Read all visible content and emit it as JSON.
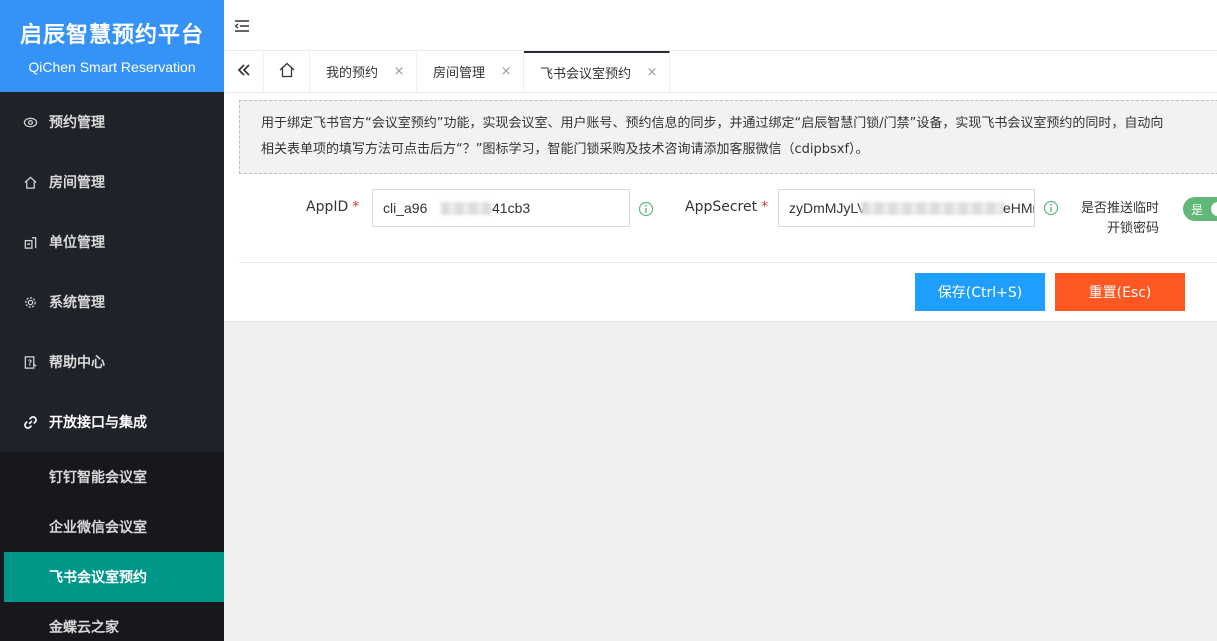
{
  "brand": {
    "title": "启辰智慧预约平台",
    "subtitle": "QiChen Smart Reservation"
  },
  "sidebar": {
    "items": [
      {
        "label": "预约管理",
        "icon": "eye-icon"
      },
      {
        "label": "房间管理",
        "icon": "home-icon"
      },
      {
        "label": "单位管理",
        "icon": "building-icon"
      },
      {
        "label": "系统管理",
        "icon": "gear-icon"
      },
      {
        "label": "帮助中心",
        "icon": "help-doc-icon"
      },
      {
        "label": "开放接口与集成",
        "icon": "link-icon"
      }
    ],
    "subitems": [
      {
        "label": "钉钉智能会议室"
      },
      {
        "label": "企业微信会议室"
      },
      {
        "label": "飞书会议室预约"
      },
      {
        "label": "金蝶云之家"
      }
    ]
  },
  "tabs": [
    {
      "label": "我的预约",
      "close": "×"
    },
    {
      "label": "房间管理",
      "close": "×"
    },
    {
      "label": "飞书会议室预约",
      "close": "×"
    }
  ],
  "notice": {
    "line1": "用于绑定飞书官方“会议室预约”功能，实现会议室、用户账号、预约信息的同步，并通过绑定“启辰智慧门锁/门禁”设备，实现飞书会议室预约的同时，自动向",
    "line2": "相关表单项的填写方法可点击后方“？”图标学习，智能门锁采购及技术咨询请添加客服微信（cdipbsxf）。"
  },
  "form": {
    "appid_label": "AppID",
    "appid_prefix": "cli_a96",
    "appid_suffix": "41cb3",
    "appsecret_label": "AppSecret",
    "appsecret_prefix": "zyDmMJyLV",
    "appsecret_suffix": "eHMr",
    "required_mark": "*",
    "push_label_line1": "是否推送临时",
    "push_label_line2": "开锁密码",
    "push_toggle": "是"
  },
  "buttons": {
    "save": "保存(Ctrl+S)",
    "reset": "重置(Esc)"
  },
  "colors": {
    "brand": "#3593f7",
    "sidebar": "#20222a",
    "active_menu": "#009688",
    "save": "#1e9fff",
    "reset": "#ff5722",
    "toggle": "#5fb878"
  }
}
